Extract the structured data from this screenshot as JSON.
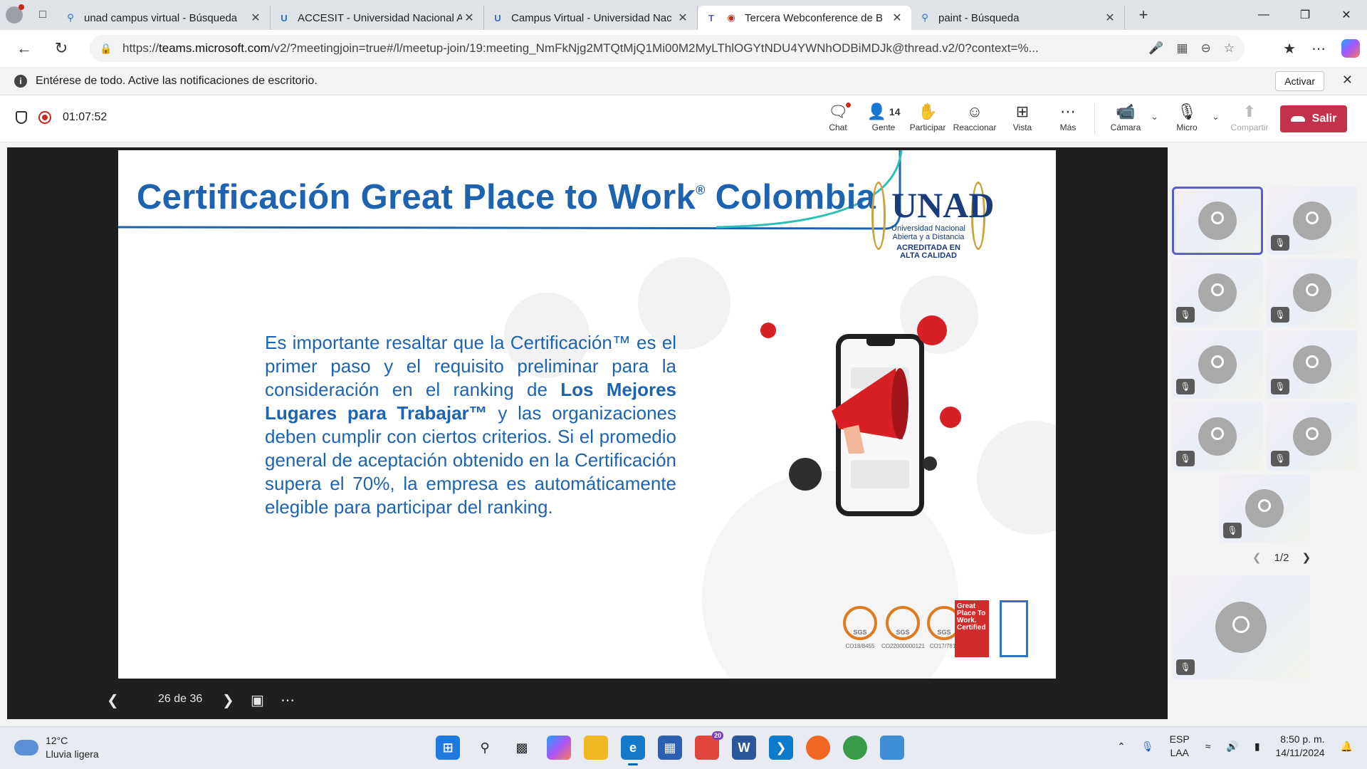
{
  "browser": {
    "tabs": [
      {
        "title": "unad campus virtual - Búsqueda",
        "icon": "search-icon"
      },
      {
        "title": "ACCESIT - Universidad Nacional A",
        "icon": "unad-icon"
      },
      {
        "title": "Campus Virtual - Universidad Nac",
        "icon": "unad-icon"
      },
      {
        "title": "Tercera Webconference de B",
        "icon": "teams-icon",
        "active": true
      },
      {
        "title": "paint - Búsqueda",
        "icon": "search-icon"
      }
    ],
    "url_prefix": "https://",
    "url_host": "teams.microsoft.com",
    "url_rest": "/v2/?meetingjoin=true#/l/meetup-join/19:meeting_NmFkNjg2MTQtMjQ1Mi00M2MyLThlOGYtNDU4YWNhODBiMDJk@thread.v2/0?context=%..."
  },
  "notification": {
    "text": "Entérese de todo. Active las notificaciones de escritorio.",
    "action": "Activar"
  },
  "meeting": {
    "timer": "01:07:52",
    "people_count": "14",
    "buttons": {
      "chat": "Chat",
      "people": "Gente",
      "raise": "Participar",
      "react": "Reaccionar",
      "view": "Vista",
      "more": "Más",
      "camera": "Cámara",
      "mic": "Micro",
      "share": "Compartir",
      "leave": "Salir"
    }
  },
  "slide": {
    "title": "Certificación Great Place to Work",
    "title_mark": "®",
    "title_end": " Colombia",
    "body_1": "Es importante resaltar que la Certificación™ es el primer paso y el requisito preliminar para la consideración en el ranking de ",
    "body_bold": "Los Mejores Lugares para Trabajar™",
    "body_2": " y las organizaciones deben cumplir con ciertos criterios. Si el promedio general de aceptación obtenido en la Certificación supera el 70%, la empresa es automáticamente elegible para participar del ranking.",
    "logo_text": "UNAD",
    "logo_sub": "Universidad Nacional Abierta y a Distancia",
    "logo_accred": "ACREDITADA EN ALTA CALIDAD",
    "cert_labels": [
      "CO18/8455",
      "CO22000000121",
      "CO17/7811"
    ],
    "gptw_text": "Great Place To Work. Certified",
    "counter": "26 de 36"
  },
  "participants": {
    "pager": "1/2"
  },
  "taskbar": {
    "weather_temp": "12°C",
    "weather_desc": "Lluvia ligera",
    "lang_1": "ESP",
    "lang_2": "LAA",
    "time": "8:50 p. m.",
    "date": "14/11/2024",
    "chrome_badge": "20"
  }
}
